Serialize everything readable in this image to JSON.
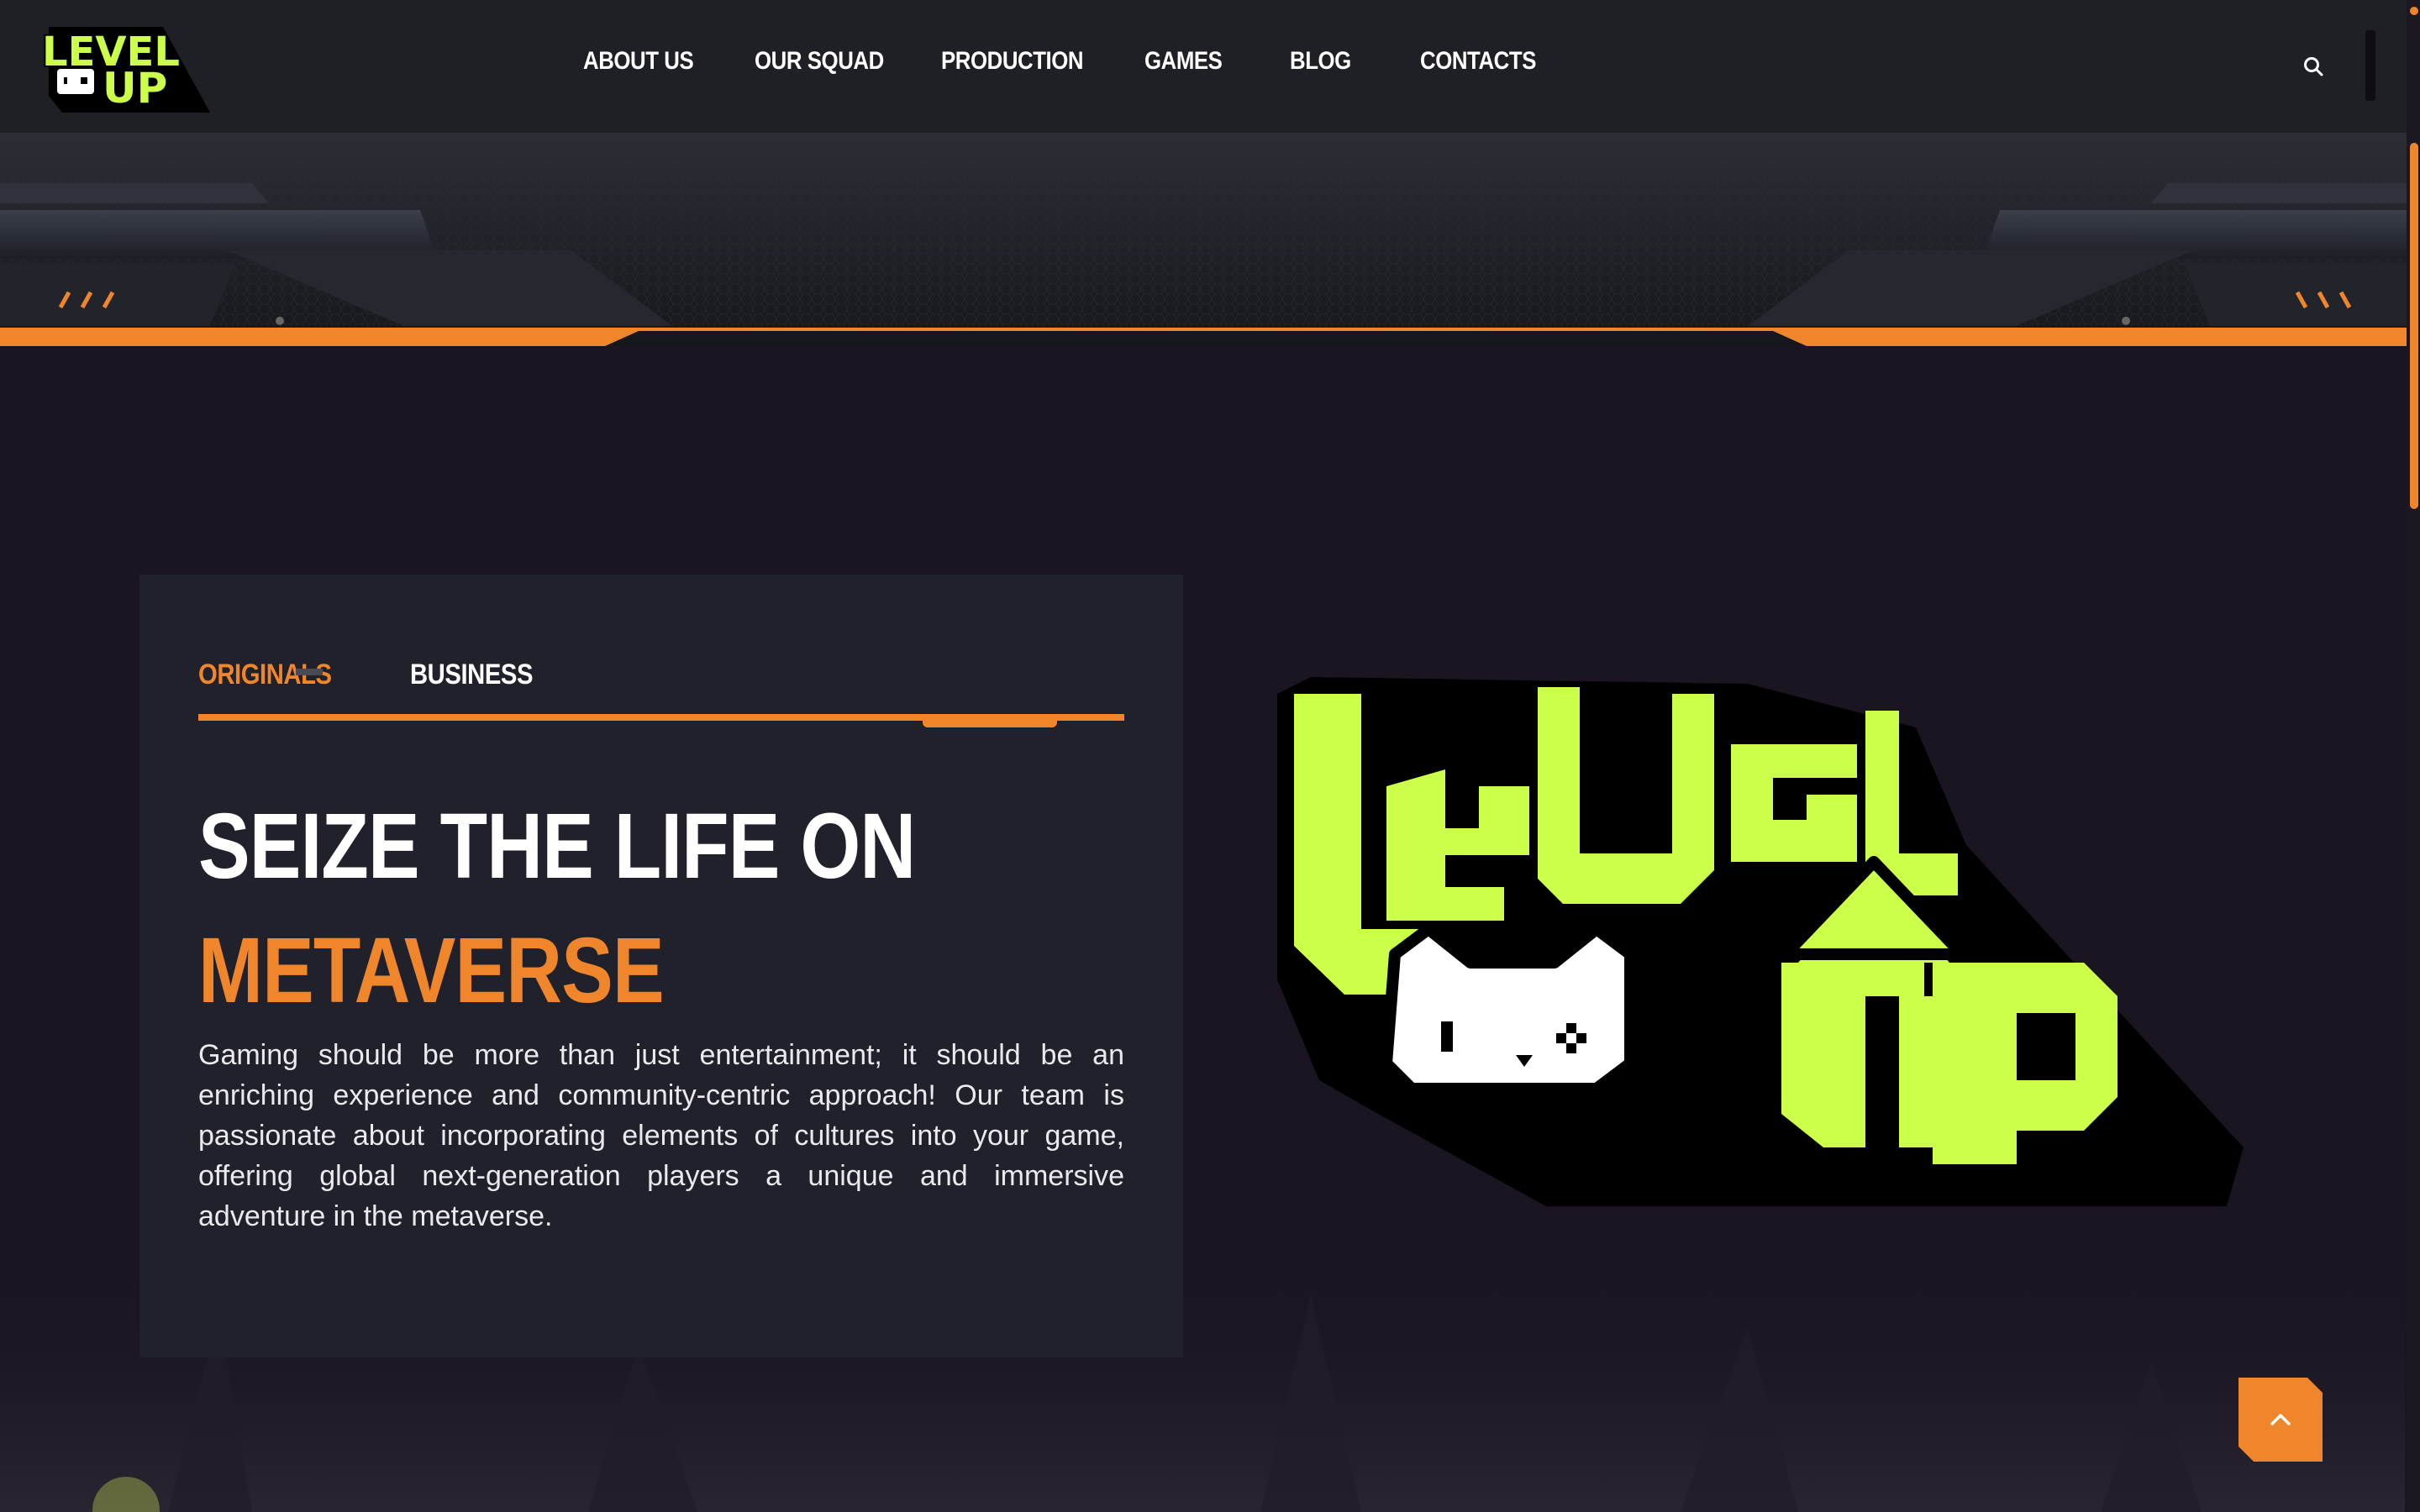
{
  "brand": {
    "logo_top_text": "LEVEL",
    "logo_bottom_text": "UP",
    "accent": "#f0862b",
    "logo_green": "#ccff4a"
  },
  "nav": {
    "items": [
      {
        "label": "ABOUT US"
      },
      {
        "label": "OUR SQUAD"
      },
      {
        "label": "PRODUCTION"
      },
      {
        "label": "GAMES"
      },
      {
        "label": "BLOG"
      },
      {
        "label": "CONTACTS"
      }
    ],
    "search_icon": "search-icon",
    "menu_icon": "menu-bar-icon"
  },
  "card": {
    "tabs": [
      {
        "label": "ORIGINALS",
        "active": true
      },
      {
        "label": "BUSINESS",
        "active": false
      }
    ],
    "headline_line1": "SEIZE THE LIFE ON",
    "headline_line2": "METAVERSE",
    "body": "Gaming should be more than just entertainment; it should be an enriching experience and community-centric approach! Our team is passionate about incorporating elements of cultures into your game, offering global next-generation players a unique and immersive adventure in the metaverse."
  },
  "back_to_top": {
    "icon": "chevron-up-icon"
  }
}
